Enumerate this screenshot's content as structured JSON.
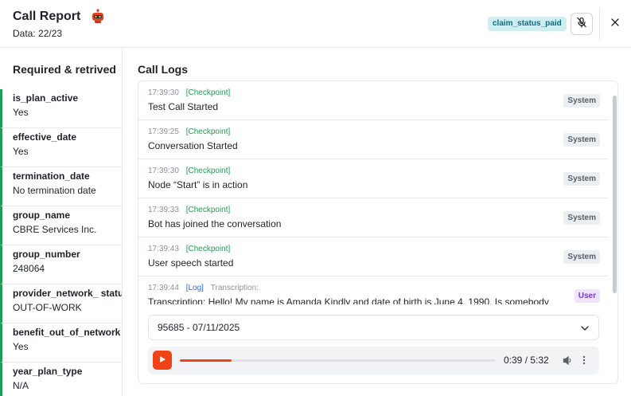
{
  "header": {
    "title": "Call Report",
    "subtitle": "Data: 22/23",
    "status_badge": "claim_status_paid",
    "icons": {
      "report": "robot-icon",
      "mic": "mic-off-icon",
      "close": "close-icon"
    }
  },
  "sidebar": {
    "title": "Required & retrived",
    "fields": [
      {
        "name": "is_plan_active",
        "value": "Yes"
      },
      {
        "name": "effective_date",
        "value": "Yes"
      },
      {
        "name": "termination_date",
        "value": "No termination date"
      },
      {
        "name": "group_name",
        "value": "CBRE Services Inc."
      },
      {
        "name": "group_number",
        "value": "248064"
      },
      {
        "name": "provider_network_ status",
        "value": "OUT-OF-WORK"
      },
      {
        "name": "benefit_out_of_network",
        "value": "Yes"
      },
      {
        "name": "year_plan_type",
        "value": "N/A"
      }
    ]
  },
  "logs": {
    "title": "Call Logs",
    "entries": [
      {
        "time": "17:39:30",
        "tag": "[Checkpoint]",
        "tag_type": "checkpoint",
        "extra": "",
        "text": "Test Call Started",
        "role": "System"
      },
      {
        "time": "17:39:25",
        "tag": "[Checkpoint]",
        "tag_type": "checkpoint",
        "extra": "",
        "text": "Conversation Started",
        "role": "System"
      },
      {
        "time": "17:39:30",
        "tag": "[Checkpoint]",
        "tag_type": "checkpoint",
        "extra": "",
        "text": "Node “Start” is in action",
        "role": "System"
      },
      {
        "time": "17:39:33",
        "tag": "[Checkpoint]",
        "tag_type": "checkpoint",
        "extra": "",
        "text": "Bot has joined the conversation",
        "role": "System"
      },
      {
        "time": "17:39:43",
        "tag": "[Checkpoint]",
        "tag_type": "checkpoint",
        "extra": "",
        "text": "User speech started",
        "role": "System"
      },
      {
        "time": "17:39:44",
        "tag": "[Log]",
        "tag_type": "log",
        "extra": "Transcription:",
        "text": "Transcription: Hello! My name is Amanda Kindly and date of birth is June 4, 1990. Is somebody",
        "role": "User"
      }
    ]
  },
  "player": {
    "recording": "95685 - 07/11/2025",
    "time": "0:39 / 5:32",
    "progress_fraction": 0.163,
    "accent_color": "#f04418",
    "icons": {
      "play": "play-icon",
      "volume": "volume-icon",
      "more": "more-vertical-icon",
      "dropdown": "chevron-down-icon"
    }
  },
  "colors": {
    "field_accent": "#1f9d55",
    "badge_bg": "#cdeef3",
    "user_badge": "#7a3ad6"
  }
}
